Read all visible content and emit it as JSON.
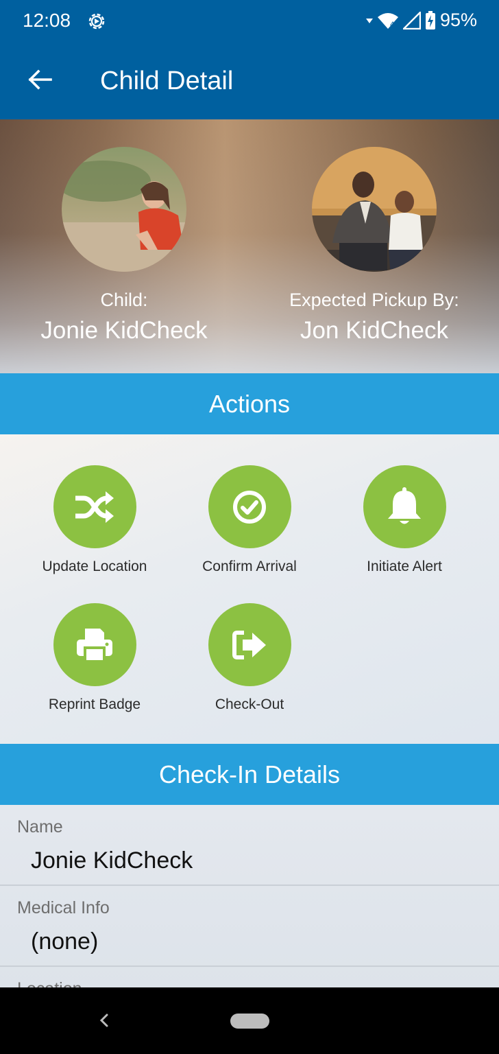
{
  "status_bar": {
    "time": "12:08",
    "battery": "95%",
    "signal_label": "4"
  },
  "app_bar": {
    "title": "Child Detail"
  },
  "hero": {
    "child_label": "Child:",
    "child_name": "Jonie KidCheck",
    "pickup_label": "Expected Pickup By:",
    "pickup_name": "Jon KidCheck"
  },
  "actions": {
    "header": "Actions",
    "items": [
      {
        "label": "Update Location",
        "icon": "shuffle-icon"
      },
      {
        "label": "Confirm Arrival",
        "icon": "check-circle-icon"
      },
      {
        "label": "Initiate Alert",
        "icon": "bell-icon"
      },
      {
        "label": "Reprint Badge",
        "icon": "printer-icon"
      },
      {
        "label": "Check-Out",
        "icon": "sign-out-icon"
      }
    ]
  },
  "checkin": {
    "header": "Check-In Details",
    "rows": [
      {
        "label": "Name",
        "value": "Jonie KidCheck"
      },
      {
        "label": "Medical Info",
        "value": "(none)"
      },
      {
        "label": "Location",
        "value": ""
      }
    ]
  },
  "colors": {
    "primary": "#00609f",
    "section": "#27a0dc",
    "action": "#8cc142"
  }
}
